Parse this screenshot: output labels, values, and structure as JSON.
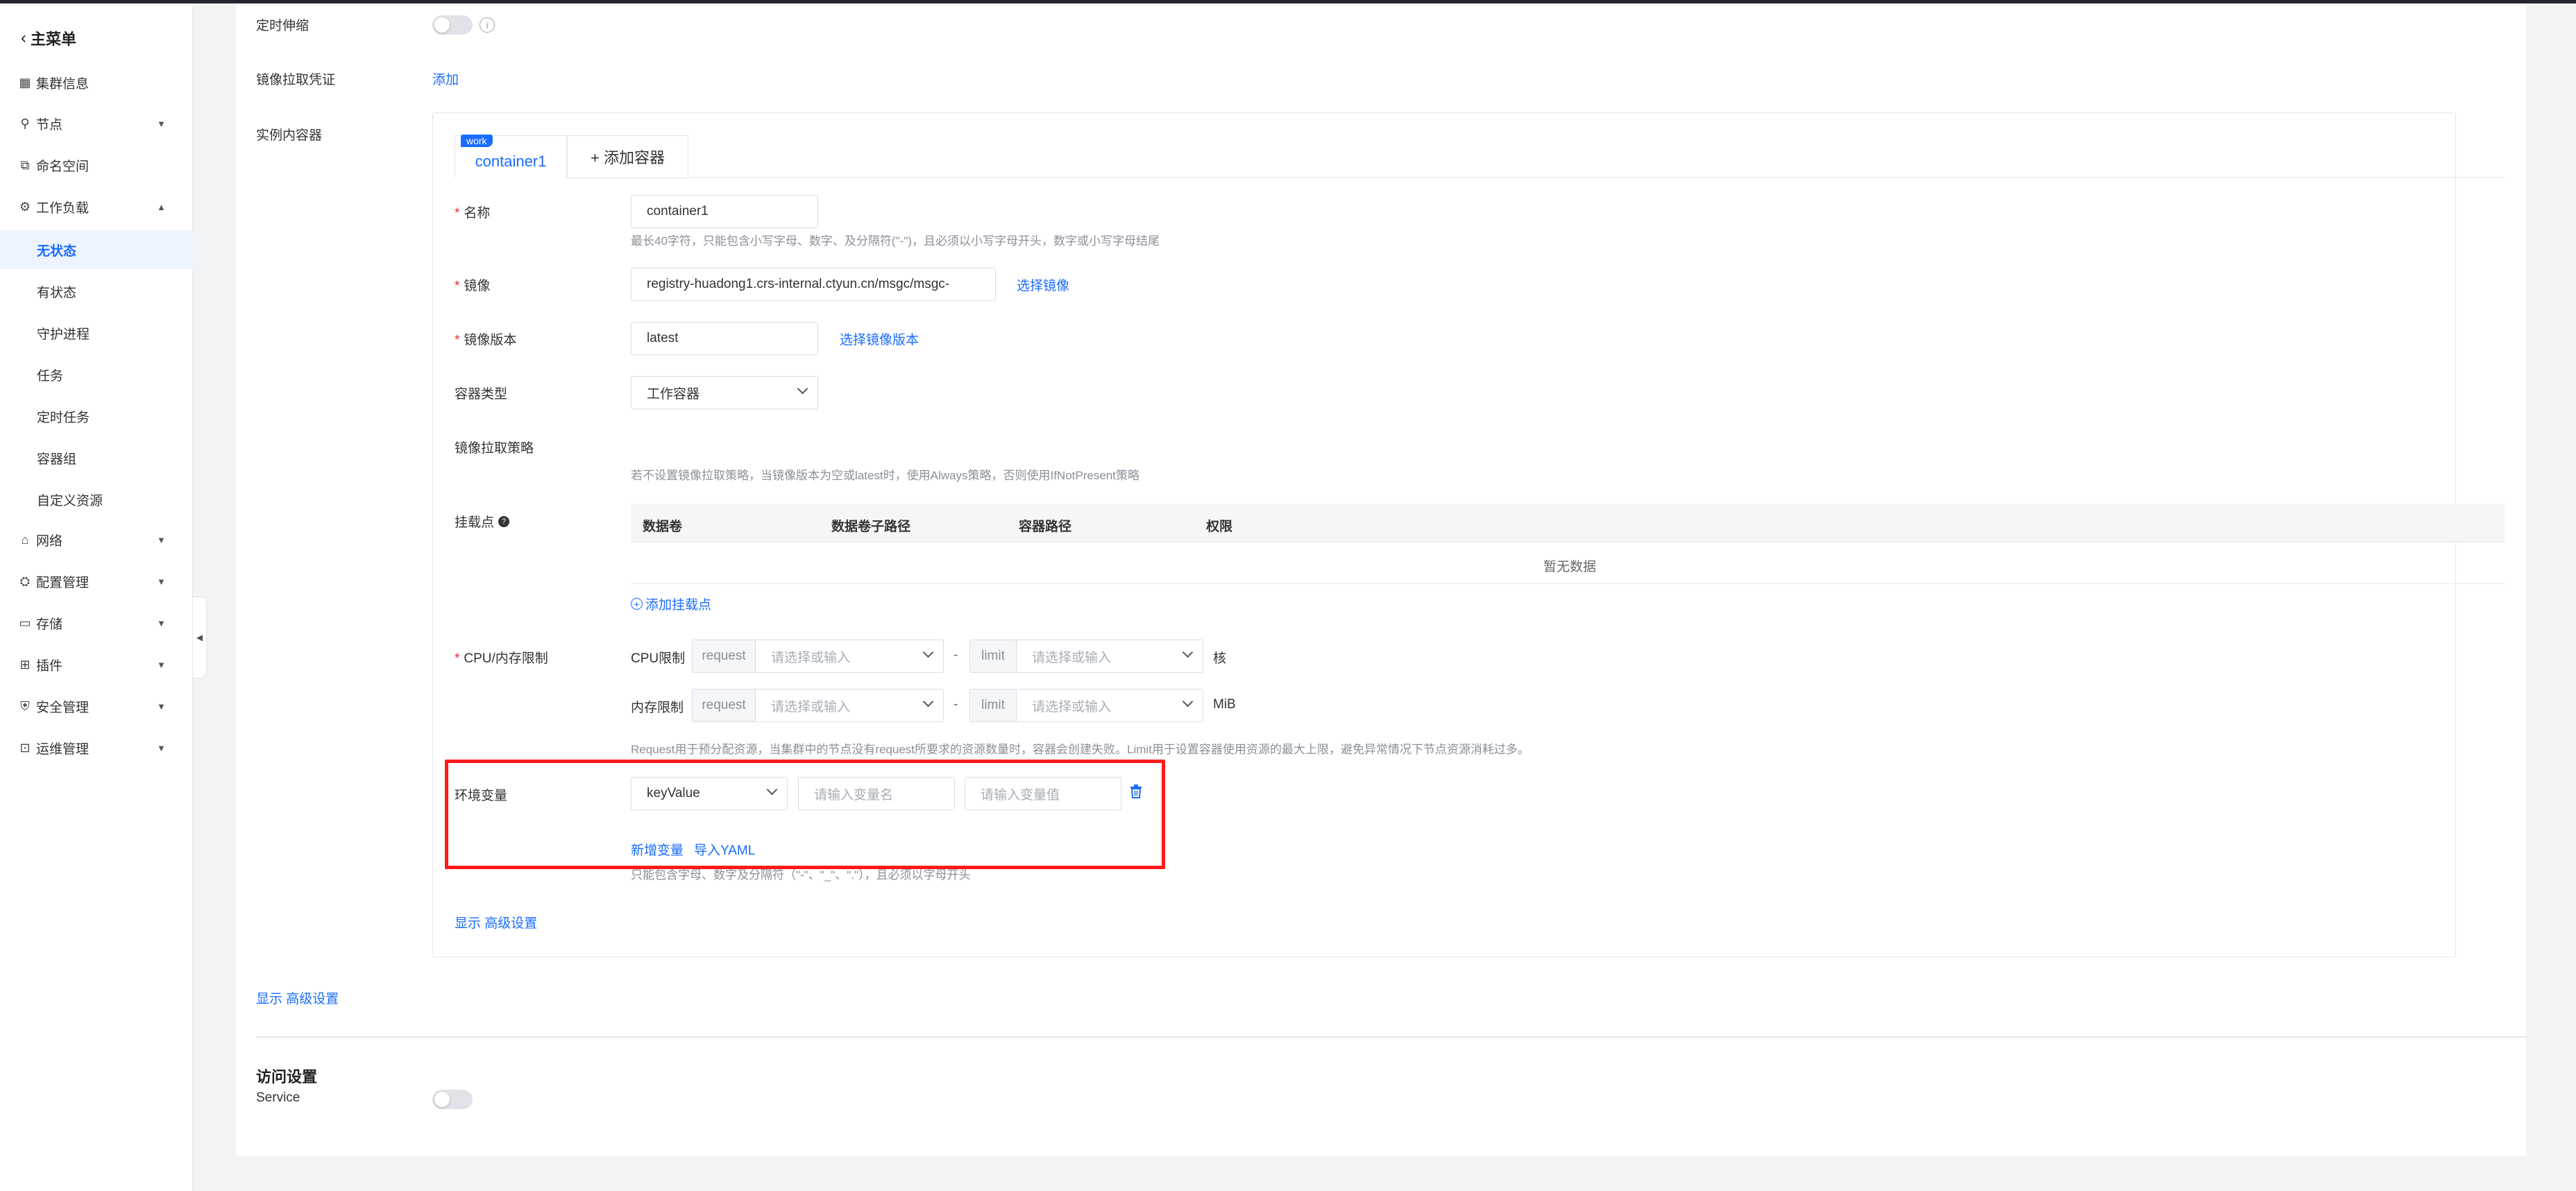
{
  "sidebar": {
    "back_label": "主菜单",
    "items": [
      {
        "label": "集群信息",
        "icon": "cluster-icon"
      },
      {
        "label": "节点",
        "icon": "node-icon"
      },
      {
        "label": "命名空间",
        "icon": "namespace-icon"
      },
      {
        "label": "工作负载",
        "icon": "workload-icon"
      },
      {
        "label": "网络",
        "icon": "network-icon"
      },
      {
        "label": "配置管理",
        "icon": "config-icon"
      },
      {
        "label": "存储",
        "icon": "storage-icon"
      },
      {
        "label": "插件",
        "icon": "plugin-icon"
      },
      {
        "label": "安全管理",
        "icon": "security-icon"
      },
      {
        "label": "运维管理",
        "icon": "ops-icon"
      }
    ],
    "sub_items": [
      "无状态",
      "有状态",
      "守护进程",
      "任务",
      "定时任务",
      "容器组",
      "自定义资源"
    ],
    "active_sub_item": "无状态"
  },
  "form": {
    "autoscale_label": "定时伸缩",
    "pull_secret_label": "镜像拉取凭证",
    "pull_secret_add": "添加",
    "instance_containers_label": "实例内容器",
    "show_advanced": "显示 高级设置"
  },
  "container": {
    "tab_badge": "work",
    "tab_name": "container1",
    "add_tab_label": "+ 添加容器",
    "name_label": "名称",
    "name_value": "container1",
    "name_hint": "最长40字符，只能包含小写字母、数字、及分隔符(\"-\")，且必须以小写字母开头，数字或小写字母结尾",
    "image_label": "镜像",
    "image_value": "registry-huadong1.crs-internal.ctyun.cn/msgc/msgc-",
    "select_image": "选择镜像",
    "image_version_label": "镜像版本",
    "image_version_value": "latest",
    "select_image_version": "选择镜像版本",
    "container_type_label": "容器类型",
    "container_type_value": "工作容器",
    "pull_policy_label": "镜像拉取策略",
    "pull_policy_hint": "若不设置镜像拉取策略，当镜像版本为空或latest时，使用Always策略，否则使用IfNotPresent策略",
    "mount_label": "挂载点",
    "mount_columns": [
      "数据卷",
      "数据卷子路径",
      "容器路径",
      "权限"
    ],
    "mount_empty": "暂无数据",
    "add_mount": "添加挂载点",
    "cpu_mem_label": "CPU/内存限制",
    "cpu_label": "CPU限制",
    "mem_label": "内存限制",
    "request_addon": "request",
    "limit_addon": "limit",
    "select_placeholder": "请选择或输入",
    "dash": "-",
    "cpu_unit": "核",
    "mem_unit": "MiB",
    "resource_hint": "Request用于预分配资源，当集群中的节点没有request所要求的资源数量时，容器会创建失败。Limit用于设置容器使用资源的最大上限，避免异常情况下节点资源消耗过多。",
    "env_label": "环境变量",
    "env_type_value": "keyValue",
    "env_name_placeholder": "请输入变量名",
    "env_value_placeholder": "请输入变量值",
    "add_env": "新增变量",
    "import_yaml": "导入YAML",
    "env_hint": "只能包含字母、数字及分隔符（\"-\"、\"_\"、\".\"），且必须以字母开头",
    "show_advanced": "显示 高级设置"
  },
  "access": {
    "title": "访问设置",
    "service_label": "Service"
  },
  "colors": {
    "accent": "#1a6cff",
    "highlight_border": "#ff1a1a",
    "required": "#f5222d"
  }
}
